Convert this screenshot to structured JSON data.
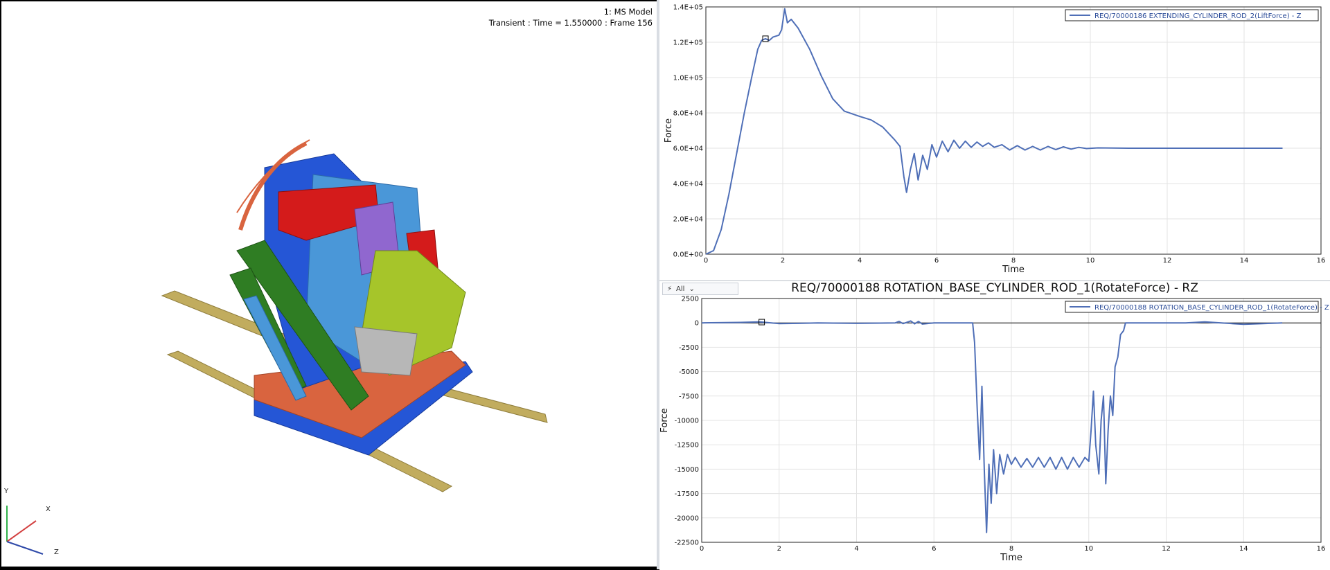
{
  "viewport": {
    "model_label": "1: MS Model",
    "transient_label": "Transient : Time = 1.550000 : Frame 156",
    "triad": {
      "y": "Y",
      "x": "X",
      "z": "Z"
    },
    "colors": {
      "blue": "#2556d6",
      "red": "#d41b1b",
      "green": "#2f7d23",
      "lime": "#a6c52a",
      "orange": "#d9643f",
      "lightblue": "#4a97d8",
      "purple": "#9067cf",
      "tan": "#c1ac5e",
      "gray": "#b7b7b7"
    }
  },
  "plot_top": {
    "title": "",
    "legend": "REQ/70000186 EXTENDING_CYLINDER_ROD_2(LiftForce) - Z"
  },
  "plot_bottom": {
    "title": "REQ/70000188 ROTATION_BASE_CYLINDER_ROD_1(RotateForce) - RZ",
    "legend": "REQ/70000188 ROTATION_BASE_CYLINDER_ROD_1(RotateForce) - Z",
    "toolbar": {
      "icon": "lightning-icon",
      "filter_label": "All"
    }
  },
  "chart_data": [
    {
      "type": "line",
      "xlabel": "Time",
      "ylabel": "Force",
      "xlim": [
        0,
        16
      ],
      "ylim": [
        0,
        140000
      ],
      "x_ticks": [
        0,
        2,
        4,
        6,
        8,
        10,
        12,
        14,
        16
      ],
      "x_tick_labels": [
        "0",
        "2",
        "4",
        "6",
        "8",
        "10",
        "12",
        "14",
        "16"
      ],
      "y_ticks": [
        0,
        20000,
        40000,
        60000,
        80000,
        100000,
        120000,
        140000
      ],
      "y_tick_labels": [
        "0.0E+00",
        "2.0E+04",
        "4.0E+04",
        "6.0E+04",
        "8.0E+04",
        "1.0E+05",
        "1.2E+05",
        "1.4E+05"
      ],
      "grid": true,
      "legend_position": "top-right",
      "series": [
        {
          "name": "REQ/70000186 EXTENDING_CYLINDER_ROD_2(LiftForce) - Z",
          "color": "#4f6fb7",
          "marker_x": 1.55,
          "points": [
            [
              0,
              0
            ],
            [
              0.2,
              2000
            ],
            [
              0.4,
              14000
            ],
            [
              0.6,
              34000
            ],
            [
              0.8,
              57000
            ],
            [
              1.0,
              80000
            ],
            [
              1.2,
              101000
            ],
            [
              1.35,
              116000
            ],
            [
              1.45,
              121000
            ],
            [
              1.55,
              122000
            ],
            [
              1.65,
              121000
            ],
            [
              1.75,
              123000
            ],
            [
              1.9,
              124000
            ],
            [
              1.97,
              127000
            ],
            [
              2.05,
              139000
            ],
            [
              2.12,
              131000
            ],
            [
              2.22,
              133000
            ],
            [
              2.4,
              128000
            ],
            [
              2.7,
              116000
            ],
            [
              3.0,
              101000
            ],
            [
              3.3,
              88000
            ],
            [
              3.6,
              81000
            ],
            [
              4.0,
              78000
            ],
            [
              4.3,
              76000
            ],
            [
              4.6,
              72000
            ],
            [
              4.9,
              65000
            ],
            [
              5.05,
              61000
            ],
            [
              5.15,
              44000
            ],
            [
              5.22,
              35000
            ],
            [
              5.32,
              48000
            ],
            [
              5.42,
              57000
            ],
            [
              5.52,
              42000
            ],
            [
              5.64,
              56000
            ],
            [
              5.76,
              48000
            ],
            [
              5.88,
              62000
            ],
            [
              6.0,
              55000
            ],
            [
              6.15,
              64000
            ],
            [
              6.3,
              58000
            ],
            [
              6.45,
              64500
            ],
            [
              6.6,
              60000
            ],
            [
              6.75,
              64000
            ],
            [
              6.9,
              60500
            ],
            [
              7.05,
              63500
            ],
            [
              7.2,
              61000
            ],
            [
              7.35,
              63000
            ],
            [
              7.5,
              60500
            ],
            [
              7.7,
              62000
            ],
            [
              7.9,
              59000
            ],
            [
              8.1,
              61500
            ],
            [
              8.3,
              59000
            ],
            [
              8.5,
              61000
            ],
            [
              8.7,
              59000
            ],
            [
              8.9,
              61000
            ],
            [
              9.1,
              59200
            ],
            [
              9.3,
              60800
            ],
            [
              9.5,
              59500
            ],
            [
              9.7,
              60500
            ],
            [
              9.9,
              59800
            ],
            [
              10.2,
              60200
            ],
            [
              11,
              60000
            ],
            [
              12,
              60000
            ],
            [
              13,
              60000
            ],
            [
              14,
              60000
            ],
            [
              15,
              60000
            ]
          ]
        }
      ]
    },
    {
      "type": "line",
      "title": "REQ/70000188 ROTATION_BASE_CYLINDER_ROD_1(RotateForce) - RZ",
      "xlabel": "Time",
      "ylabel": "Force",
      "xlim": [
        0,
        16
      ],
      "ylim": [
        -22500,
        2500
      ],
      "x_ticks": [
        0,
        2,
        4,
        6,
        8,
        10,
        12,
        14,
        16
      ],
      "x_tick_labels": [
        "0",
        "2",
        "4",
        "6",
        "8",
        "10",
        "12",
        "14",
        "16"
      ],
      "y_ticks": [
        2500,
        0,
        -2500,
        -5000,
        -7500,
        -10000,
        -12500,
        -15000,
        -17500,
        -20000,
        -22500
      ],
      "y_tick_labels": [
        "2500",
        "0",
        "-2500",
        "-5000",
        "-7500",
        "-10000",
        "-12500",
        "-15000",
        "-17500",
        "-20000",
        "-22500"
      ],
      "grid": true,
      "legend_position": "top-right",
      "series": [
        {
          "name": "REQ/70000188 ROTATION_BASE_CYLINDER_ROD_1(RotateForce) - Z",
          "color": "#4f6fb7",
          "marker_x": 1.55,
          "points": [
            [
              0,
              0
            ],
            [
              1,
              50
            ],
            [
              1.5,
              100
            ],
            [
              2,
              -80
            ],
            [
              2.5,
              -50
            ],
            [
              3,
              0
            ],
            [
              4,
              -50
            ],
            [
              5,
              0
            ],
            [
              5.1,
              150
            ],
            [
              5.2,
              -80
            ],
            [
              5.4,
              200
            ],
            [
              5.5,
              -100
            ],
            [
              5.6,
              150
            ],
            [
              5.7,
              -120
            ],
            [
              6,
              0
            ],
            [
              7,
              0
            ],
            [
              7.05,
              -2000
            ],
            [
              7.12,
              -9000
            ],
            [
              7.18,
              -14000
            ],
            [
              7.24,
              -6500
            ],
            [
              7.3,
              -15000
            ],
            [
              7.36,
              -21500
            ],
            [
              7.42,
              -14500
            ],
            [
              7.48,
              -18500
            ],
            [
              7.54,
              -13000
            ],
            [
              7.62,
              -17500
            ],
            [
              7.7,
              -13500
            ],
            [
              7.8,
              -15500
            ],
            [
              7.9,
              -13500
            ],
            [
              8.0,
              -14500
            ],
            [
              8.1,
              -13800
            ],
            [
              8.25,
              -14800
            ],
            [
              8.4,
              -13900
            ],
            [
              8.55,
              -14800
            ],
            [
              8.7,
              -13800
            ],
            [
              8.85,
              -14800
            ],
            [
              9.0,
              -13800
            ],
            [
              9.15,
              -15000
            ],
            [
              9.3,
              -13800
            ],
            [
              9.45,
              -15000
            ],
            [
              9.6,
              -13800
            ],
            [
              9.75,
              -14800
            ],
            [
              9.9,
              -13800
            ],
            [
              10.0,
              -14200
            ],
            [
              10.06,
              -11000
            ],
            [
              10.12,
              -7000
            ],
            [
              10.18,
              -12500
            ],
            [
              10.26,
              -15500
            ],
            [
              10.32,
              -10000
            ],
            [
              10.38,
              -7500
            ],
            [
              10.44,
              -16500
            ],
            [
              10.5,
              -11000
            ],
            [
              10.56,
              -7500
            ],
            [
              10.62,
              -9500
            ],
            [
              10.68,
              -4500
            ],
            [
              10.75,
              -3500
            ],
            [
              10.82,
              -1200
            ],
            [
              10.9,
              -800
            ],
            [
              10.95,
              0
            ],
            [
              11.5,
              0
            ],
            [
              12.5,
              0
            ],
            [
              13,
              100
            ],
            [
              14,
              -150
            ],
            [
              15,
              0
            ]
          ]
        }
      ]
    }
  ]
}
